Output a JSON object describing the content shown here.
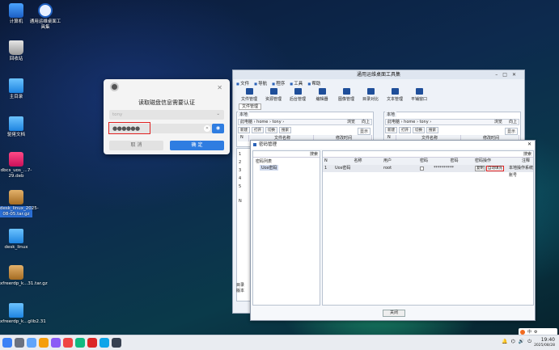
{
  "desktop": {
    "icons": [
      {
        "label": "计算机"
      },
      {
        "label": "通用运维桌面工具集"
      },
      {
        "label": "回收站"
      },
      {
        "label": "主目录"
      },
      {
        "label": "驱佬文档"
      },
      {
        "label": "dbcs_uos_...7-29.deb"
      },
      {
        "label": "desk_linux_2025-08-05.tar.gz"
      },
      {
        "label": "desk_linux"
      },
      {
        "label": "xfreerdp_k...31.tar.gz"
      },
      {
        "label": "xfreerdp_k...glib2.31"
      }
    ]
  },
  "auth_dialog": {
    "title": "读取磁盘信息需要认证",
    "username": "tony",
    "password_mask": "●●●●●●",
    "cancel_label": "取 消",
    "ok_label": "确 定"
  },
  "main_window": {
    "title": "通用运维桌面工具集",
    "menu": [
      "文件",
      "导航",
      "程序",
      "工具",
      "帮助"
    ],
    "toolbar": [
      "文件管理",
      "资源管理",
      "后台管理",
      "编辑器",
      "图像管理",
      "目录对比",
      "文本管理",
      "平铺窗口"
    ],
    "active_tab": "文件管理",
    "left_pane": {
      "tab": "本地",
      "path": "此电脑 › home › tony ›",
      "buttons": [
        "新建",
        "打开",
        "切换",
        "搜索"
      ],
      "show_label": "显示",
      "browse_label": "浏览",
      "up_label": "向上",
      "columns": [
        "N",
        "文件名称",
        "修改时间"
      ]
    },
    "right_pane": {
      "tab": "本地",
      "path": "此电脑 › home › tony ›",
      "buttons": [
        "新建",
        "打开",
        "切换",
        "搜索"
      ],
      "show_label": "显示",
      "browse_label": "浏览",
      "up_label": "向上",
      "columns": [
        "N",
        "文件名称",
        "修改时间"
      ]
    },
    "left_rows": [
      "1",
      "2",
      "3",
      "4",
      "5"
    ],
    "left_lower_label": "N",
    "status_left": "目录",
    "status_local": "版本"
  },
  "password_manager": {
    "title": "密码管理",
    "search_label": "搜索",
    "tree_root": "密码列表",
    "tree_child": "Uos密码",
    "columns": [
      "N",
      "名称",
      "用户",
      "密码",
      "密码",
      "密码操作",
      "注释"
    ],
    "row": {
      "n": "1",
      "name": "Uos密码",
      "user": "root",
      "password_mask": "**********",
      "copy_label": "复制",
      "autofill_label": "自动填充",
      "note": "本地操作系统账号"
    },
    "close_label": "关闭"
  },
  "taskbar": {
    "time": "19:40",
    "date": "2025/08/28",
    "ime_label": "中"
  }
}
